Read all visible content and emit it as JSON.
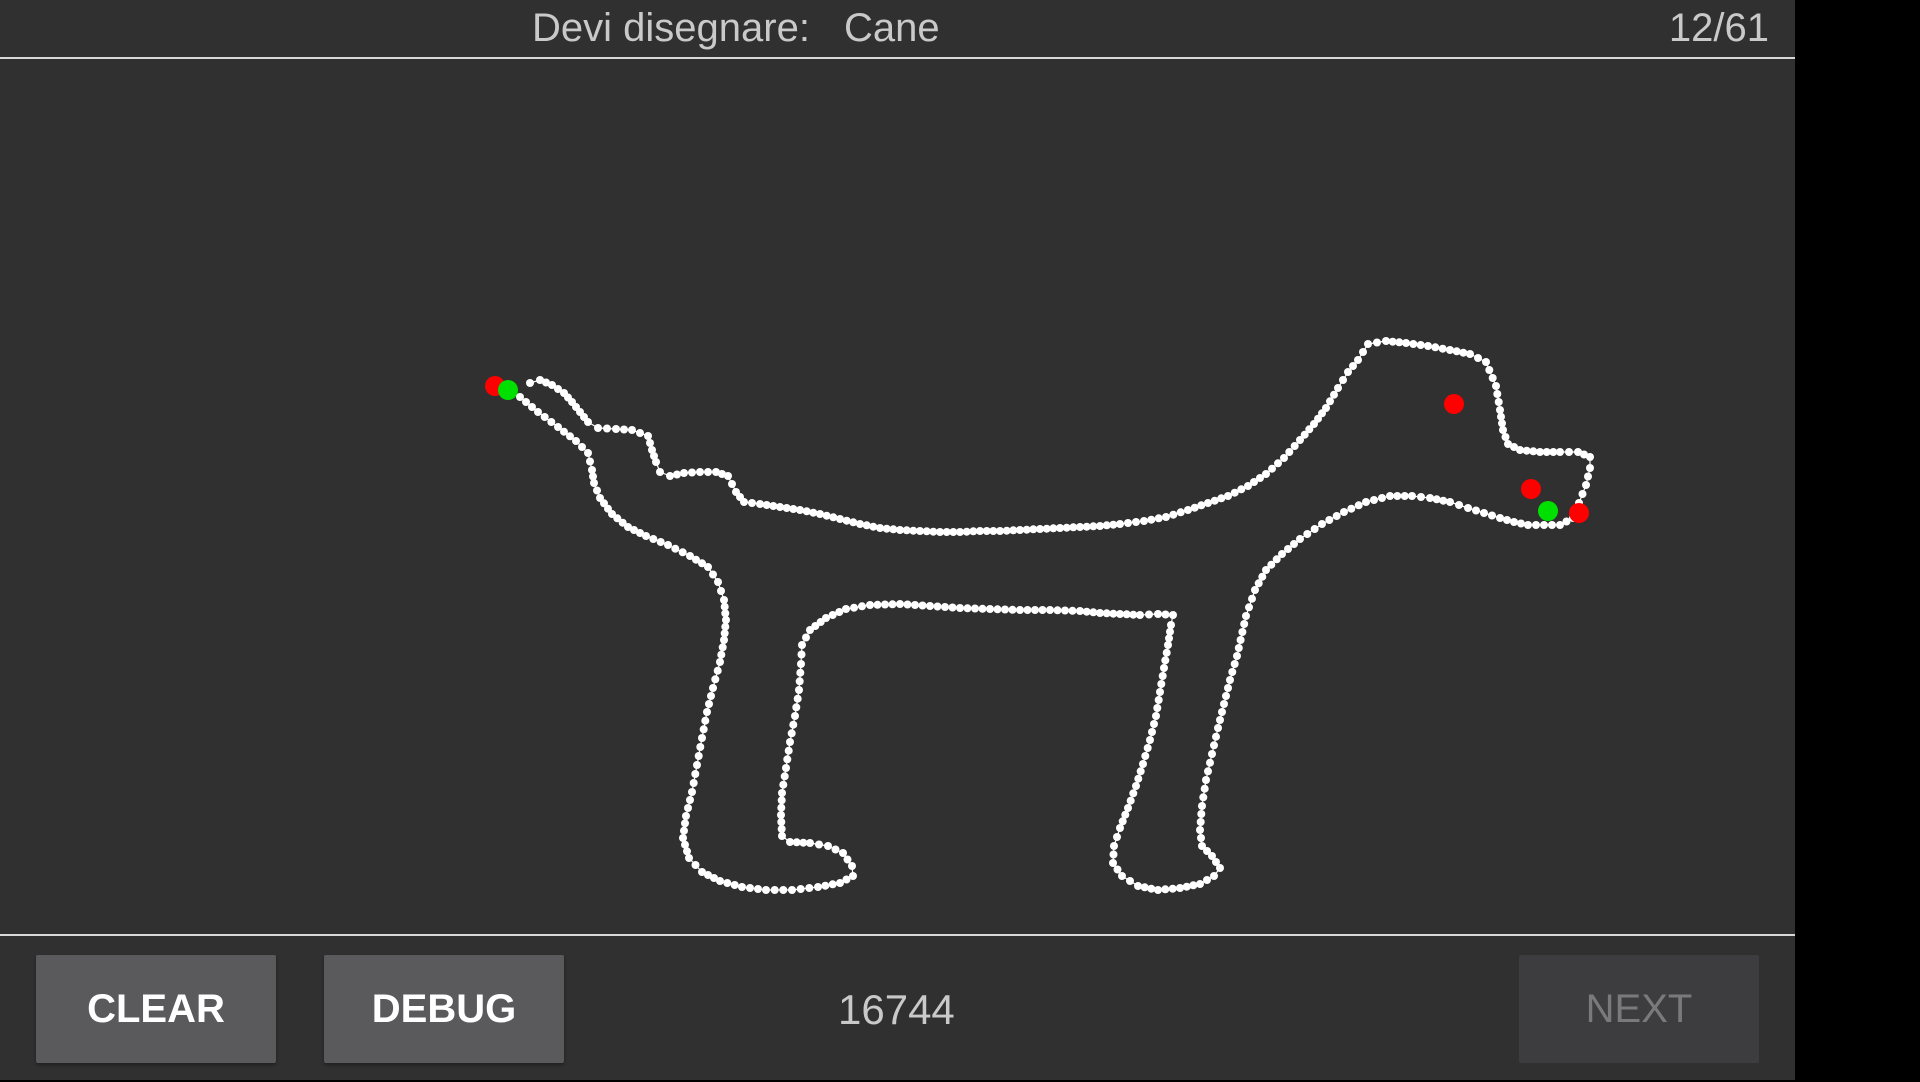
{
  "header": {
    "prompt_label": "Devi disegnare:",
    "target_word": "Cane",
    "progress": "12/61"
  },
  "footer": {
    "clear_label": "CLEAR",
    "debug_label": "DEBUG",
    "score": "16744",
    "next_label": "NEXT"
  },
  "colors": {
    "background": "#303030",
    "stroke": "#ffffff",
    "marker_red": "#ff0000",
    "marker_green": "#00e000"
  }
}
